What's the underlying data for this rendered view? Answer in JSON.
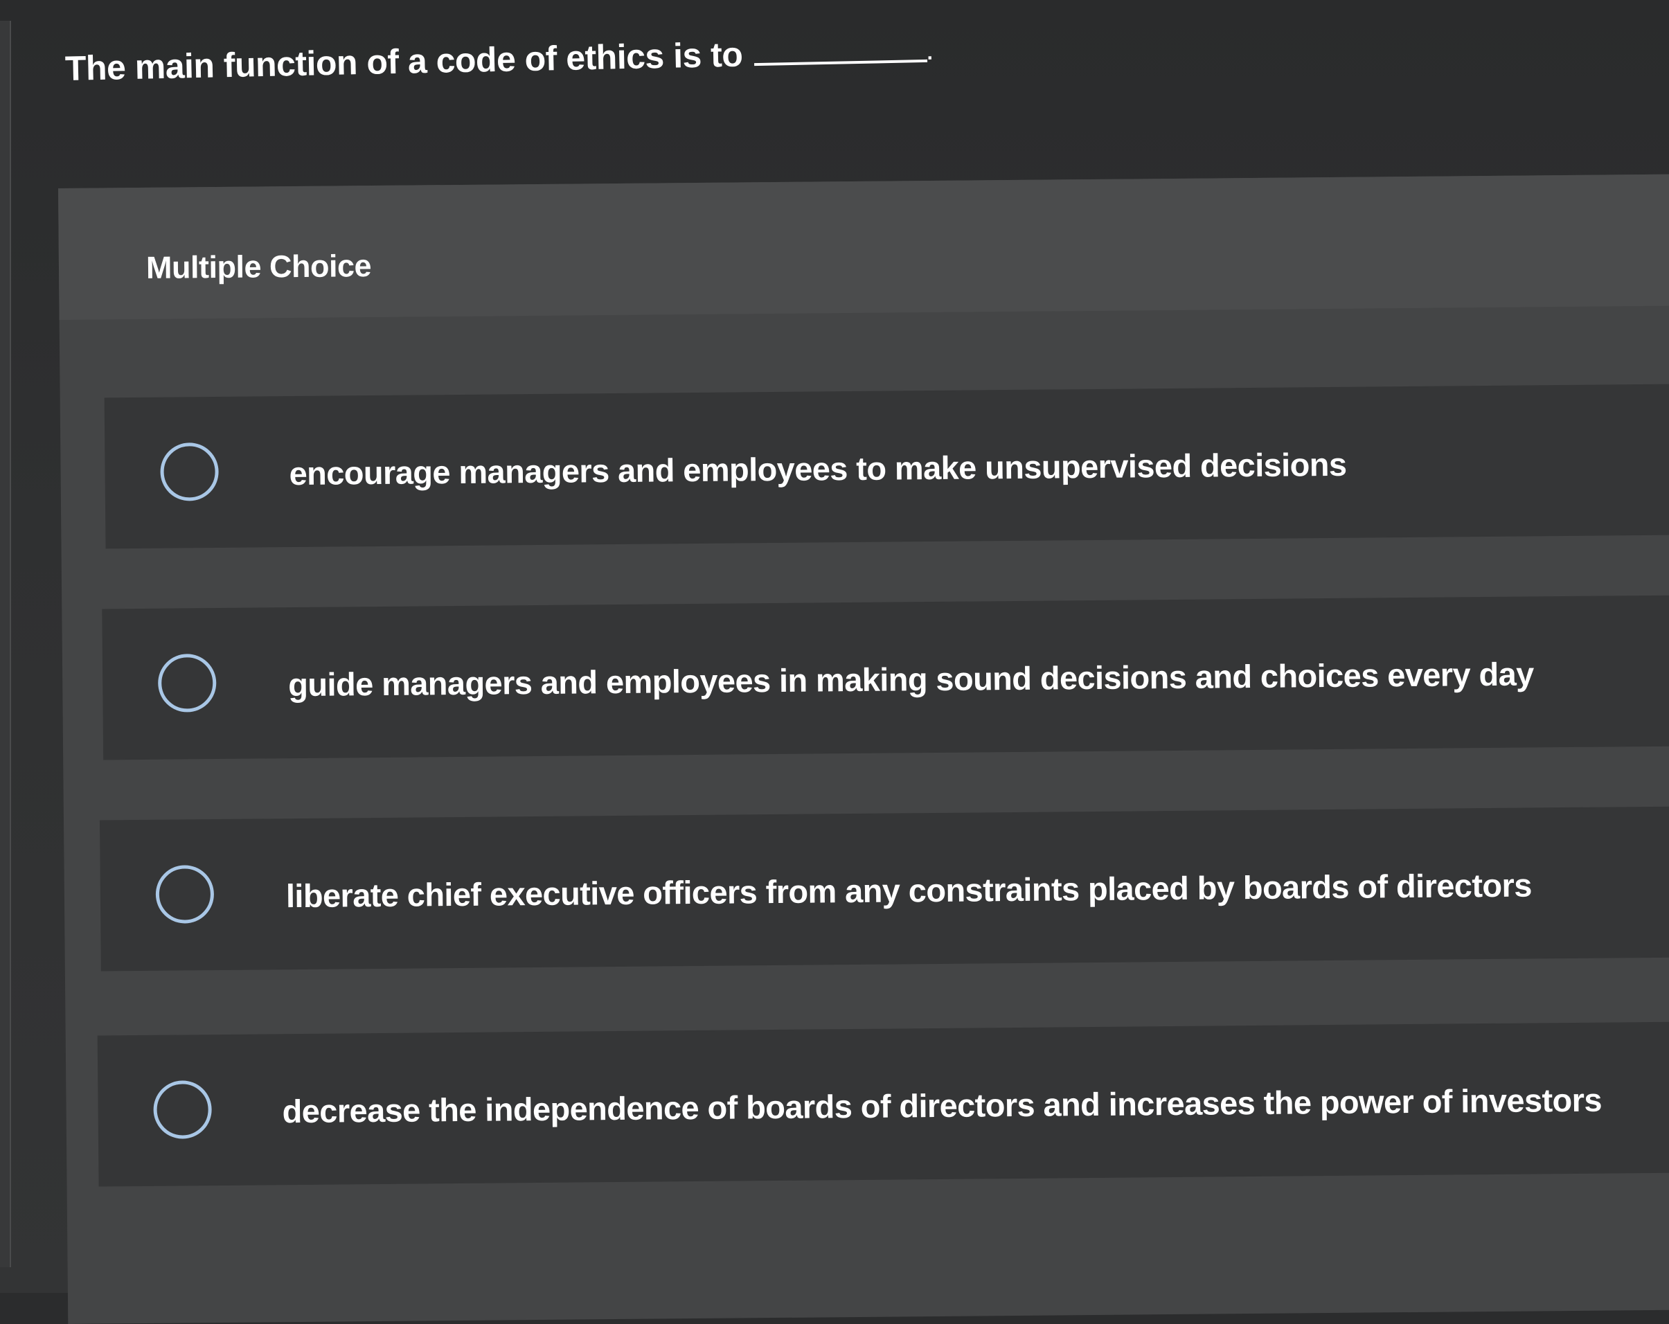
{
  "question": {
    "text": "The main function of a code of ethics is to"
  },
  "section_label": "Multiple Choice",
  "options": [
    {
      "label": "encourage managers and employees to make unsupervised decisions",
      "selected": false
    },
    {
      "label": "guide managers and employees in making sound decisions and choices every day",
      "selected": false
    },
    {
      "label": "liberate chief executive officers from any constraints placed by boards of directors",
      "selected": false
    },
    {
      "label": "decrease the independence of boards of directors and increases the power of investors",
      "selected": false
    }
  ],
  "colors": {
    "background": "#2b2c2d",
    "panel": "#444546",
    "option_row": "#353637",
    "radio_border": "#a9c7e6",
    "text": "#ffffff"
  }
}
